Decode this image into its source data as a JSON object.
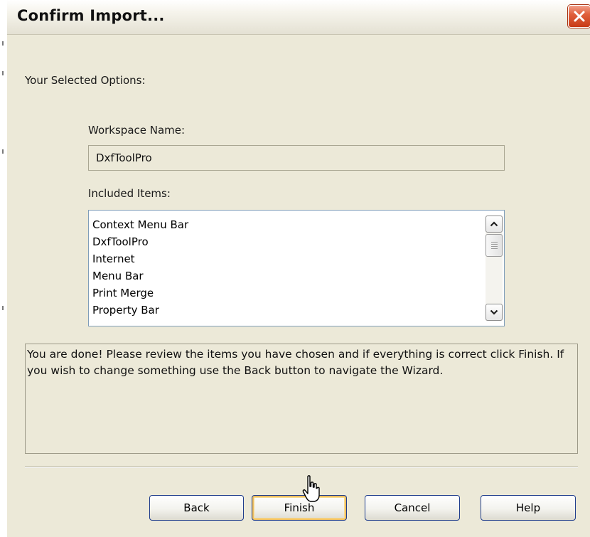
{
  "window": {
    "title": "Confirm Import...",
    "close_icon": "close-x-icon"
  },
  "main": {
    "selected_options_label": "Your Selected Options:",
    "workspace_name_label": "Workspace Name:",
    "workspace_name_value": "DxfToolPro",
    "included_items_label": "Included Items:",
    "included_items": [
      "Context Menu Bar",
      "DxfToolPro",
      "Internet",
      "Menu Bar",
      "Print Merge",
      "Property Bar"
    ],
    "info_text": "You are done! Please review the items you have chosen and if everything is correct click Finish. If you wish to change something use the Back button to navigate the Wizard."
  },
  "buttons": {
    "back": "Back",
    "finish": "Finish",
    "cancel": "Cancel",
    "help": "Help"
  },
  "colors": {
    "dialog_background": "#ece9d8",
    "close_button": "#e0603c",
    "button_border": "#1f3d8c",
    "default_button_highlight": "#f0c060"
  }
}
